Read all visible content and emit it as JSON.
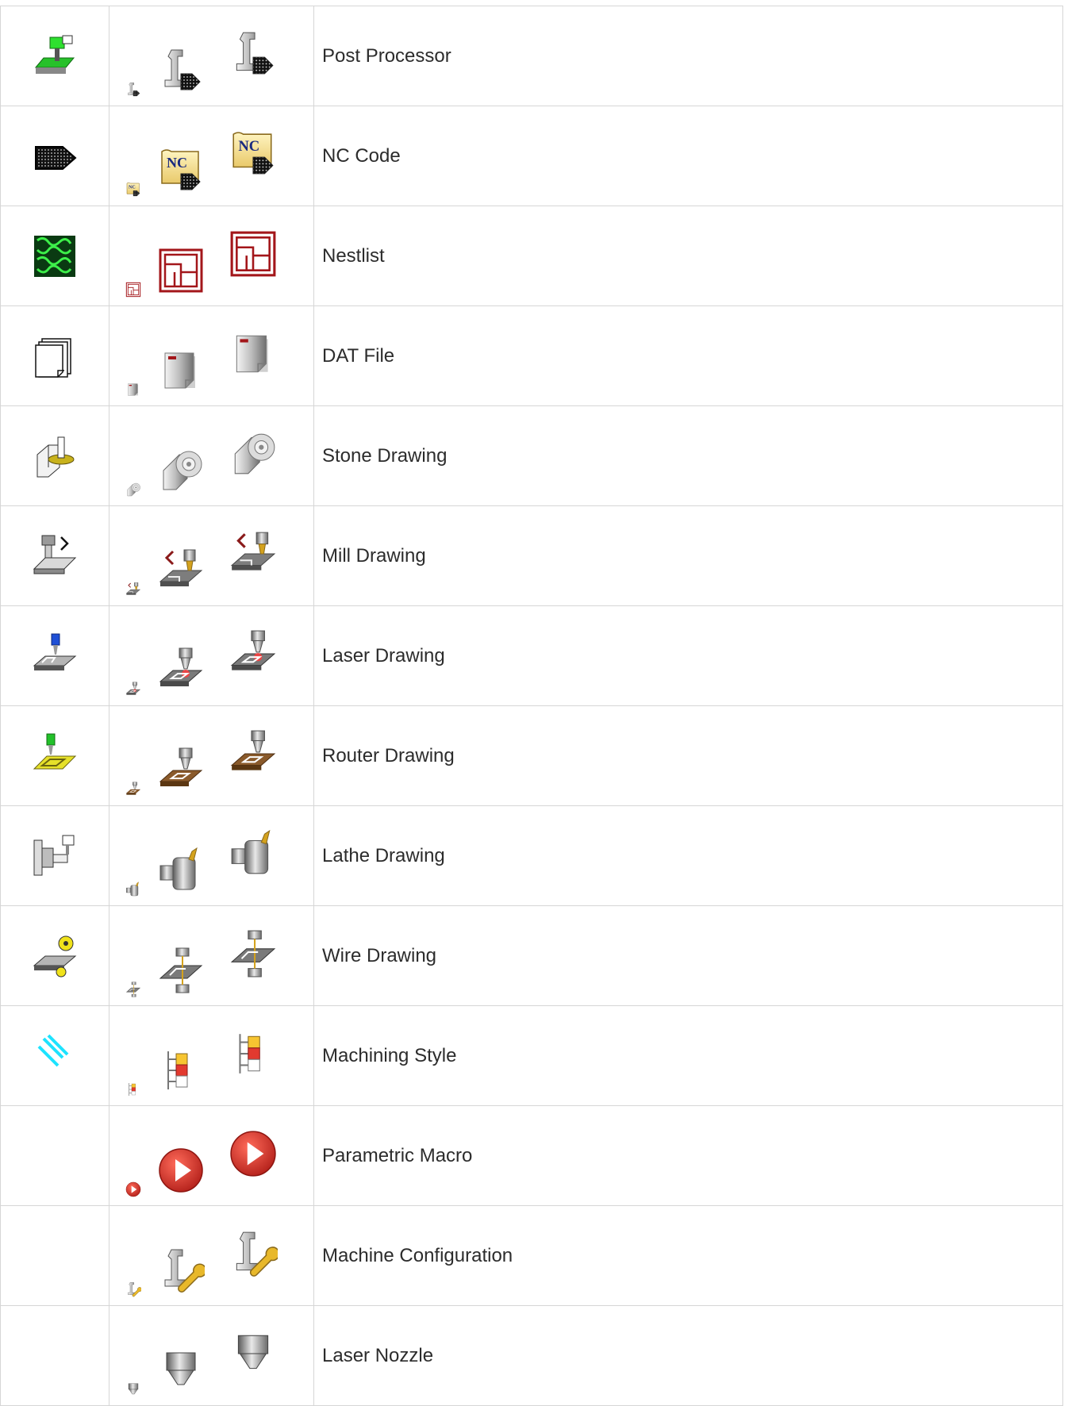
{
  "rows": [
    {
      "label": "Post Processor",
      "old_icon": "green-machine-post-icon",
      "new_icon": "post-processor-icon"
    },
    {
      "label": "NC Code",
      "old_icon": "dotted-arrow-icon",
      "new_icon": "nc-code-scroll-icon"
    },
    {
      "label": "Nestlist",
      "old_icon": "green-nest-pattern-icon",
      "new_icon": "nestlist-icon"
    },
    {
      "label": "DAT File",
      "old_icon": "page-stack-icon",
      "new_icon": "dat-file-icon"
    },
    {
      "label": "Stone Drawing",
      "old_icon": "stone-saw-icon",
      "new_icon": "stone-drawing-icon"
    },
    {
      "label": "Mill Drawing",
      "old_icon": "mill-spindle-icon",
      "new_icon": "mill-drawing-icon"
    },
    {
      "label": "Laser Drawing",
      "old_icon": "laser-head-icon",
      "new_icon": "laser-drawing-icon"
    },
    {
      "label": "Router Drawing",
      "old_icon": "router-yellow-icon",
      "new_icon": "router-drawing-icon"
    },
    {
      "label": "Lathe Drawing",
      "old_icon": "lathe-chuck-icon",
      "new_icon": "lathe-drawing-icon"
    },
    {
      "label": "Wire Drawing",
      "old_icon": "wire-spool-icon",
      "new_icon": "wire-drawing-icon"
    },
    {
      "label": "Machining Style",
      "old_icon": "cyan-hatch-icon",
      "new_icon": "machining-style-icon"
    },
    {
      "label": "Parametric Macro",
      "old_icon": "",
      "new_icon": "play-macro-icon"
    },
    {
      "label": "Machine Configuration",
      "old_icon": "",
      "new_icon": "machine-wrench-icon"
    },
    {
      "label": "Laser Nozzle",
      "old_icon": "",
      "new_icon": "laser-nozzle-icon"
    }
  ]
}
